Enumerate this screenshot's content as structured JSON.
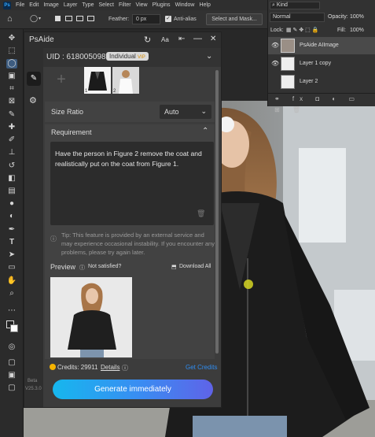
{
  "menubar": {
    "logo": "Ps",
    "items": [
      "File",
      "Edit",
      "Image",
      "Layer",
      "Type",
      "Select",
      "Filter",
      "View",
      "Plugins",
      "Window",
      "Help"
    ]
  },
  "options_bar": {
    "feather_label": "Feather:",
    "feather_value": "0 px",
    "antialias_label": "Anti-alias",
    "select_mask_button": "Select and Mask..."
  },
  "layers_panel": {
    "kind_label": "Kind",
    "blend_mode": "Normal",
    "opacity_label": "Opacity:",
    "opacity_value": "100%",
    "lock_label": "Lock:",
    "fill_label": "Fill:",
    "fill_value": "100%",
    "layers": [
      {
        "name": "PsAide AIImage",
        "selected": true
      },
      {
        "name": "Layer 1 copy",
        "selected": false
      },
      {
        "name": "Layer 2",
        "selected": false
      }
    ]
  },
  "plugin": {
    "title": "PsAide",
    "uid_label": "UID : 618005098",
    "plan_badge": "Individual",
    "plan_tag": "VIP",
    "thumbnails": [
      "1",
      "2"
    ],
    "size_ratio_label": "Size Ratio",
    "size_ratio_value": "Auto",
    "requirement_label": "Requirement",
    "requirement_text": "Have the person in Figure 2 remove the coat and realistically put on the coat from Figure 1.",
    "tip_text": "Tip: This feature is provided by an external service and may experience occasional instability. If you encounter any problems, please try again later.",
    "preview_label": "Preview",
    "not_satisfied": "Not satisfied?",
    "download_all": "Download All",
    "credits_label": "Credits: 29911",
    "details_label": "Details",
    "get_credits": "Get Credits",
    "generate_button": "Generate immediately",
    "beta_label": "Beta",
    "version": "V25.3.0"
  },
  "colors": {
    "accent": "#2f8cf0",
    "gradient_start": "#16b7ee",
    "gradient_end": "#5f63e8",
    "credits_coin": "#f5b301"
  }
}
